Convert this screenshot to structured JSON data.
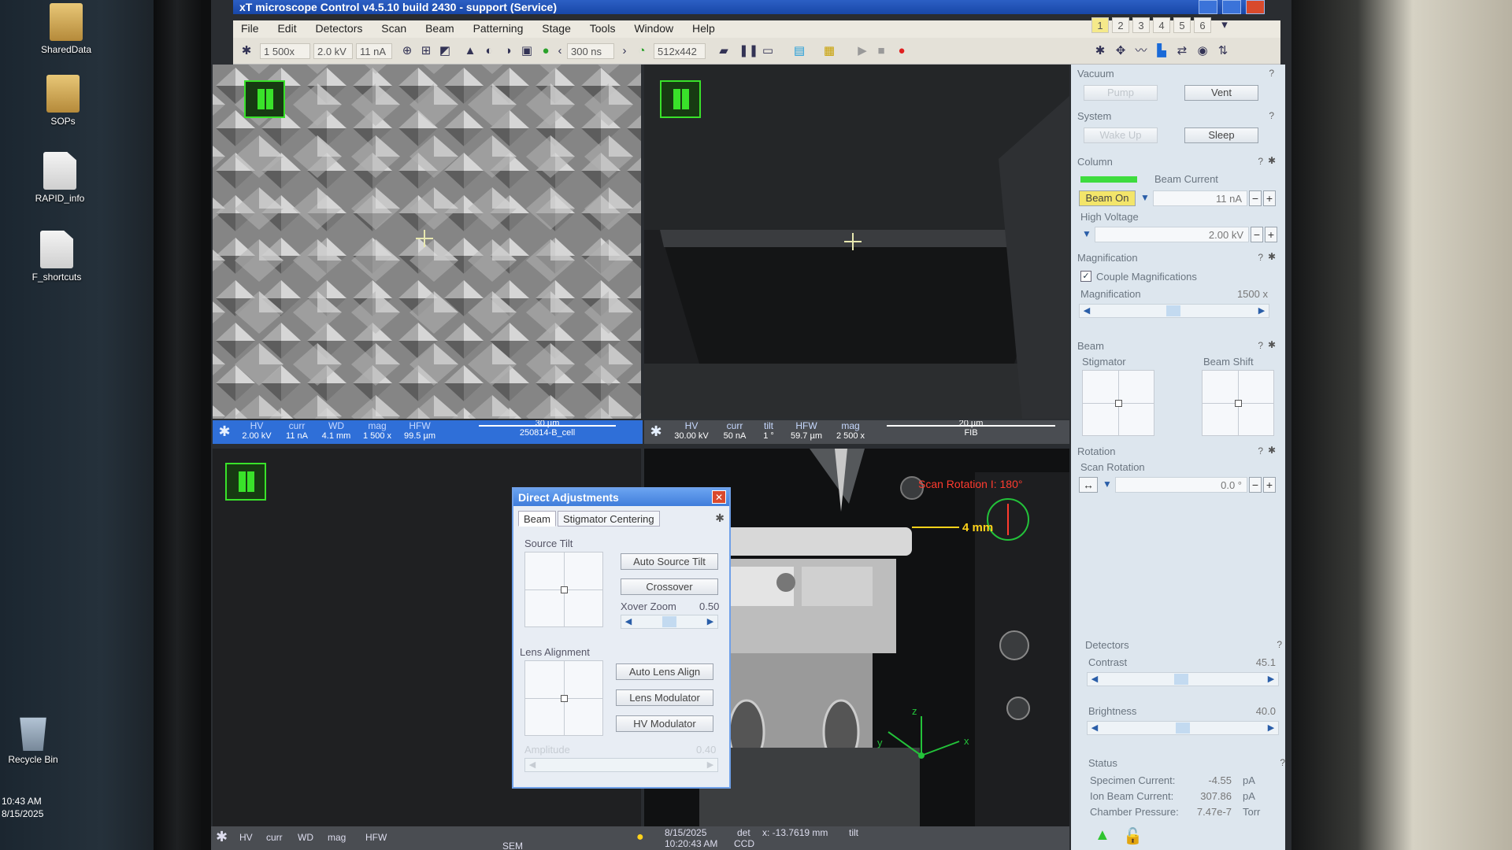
{
  "desktop": {
    "icons": [
      {
        "label": "SharedData"
      },
      {
        "label": "SOPs"
      },
      {
        "label": "RAPID_info"
      },
      {
        "label": "F_shortcuts"
      },
      {
        "label": "Recycle Bin"
      }
    ],
    "clock": {
      "time": "10:43 AM",
      "date": "8/15/2025"
    }
  },
  "window": {
    "title": "xT microscope Control v4.5.10 build 2430 - support (Service)"
  },
  "menu": [
    "File",
    "Edit",
    "Detectors",
    "Scan",
    "Beam",
    "Patterning",
    "Stage",
    "Tools",
    "Window",
    "Help"
  ],
  "toolbar": {
    "mag": "1 500x",
    "hv": "2.0 kV",
    "curr": "11 nA",
    "dwell": "300 ns",
    "resolution": "512x442"
  },
  "layout_tabs": [
    "1",
    "2",
    "3",
    "4",
    "5",
    "6"
  ],
  "sem_bar": {
    "hv_label": "HV",
    "hv_value": "2.00 kV",
    "curr_label": "curr",
    "curr_value": "11 nA",
    "wd_label": "WD",
    "wd_value": "4.1 mm",
    "mag_label": "mag",
    "mag_value": "1 500 x",
    "hfw_label": "HFW",
    "hfw_value": "99.5 µm",
    "scale_label": "30 µm",
    "sample_label": "250814-B_cell"
  },
  "fib_bar": {
    "hv_label": "HV",
    "hv_value": "30.00 kV",
    "curr_label": "curr",
    "curr_value": "50 nA",
    "tilt_label": "tilt",
    "tilt_value": "1 °",
    "hfw_label": "HFW",
    "hfw_value": "59.7 µm",
    "mag_label": "mag",
    "mag_value": "2 500 x",
    "scale_label": "20 µm",
    "mode_label": "FIB"
  },
  "ccd_view": {
    "scan_rotation": "Scan Rotation I: 180°",
    "distance": "4 mm",
    "axes": [
      "z",
      "y",
      "x"
    ]
  },
  "bottom_bar": {
    "labels": [
      "HV",
      "curr",
      "WD",
      "mag",
      "HFW"
    ],
    "mode": "SEM",
    "date": "8/15/2025",
    "time": "10:20:43 AM",
    "det_label": "det",
    "det_value": "CCD",
    "coord": "x: -13.7619 mm",
    "tilt_label": "tilt"
  },
  "dialog": {
    "title": "Direct Adjustments",
    "tabs": [
      "Beam",
      "Stigmator Centering"
    ],
    "source_tilt": "Source Tilt",
    "auto_source_tilt": "Auto Source Tilt",
    "crossover": "Crossover",
    "xover_zoom_label": "Xover Zoom",
    "xover_zoom_value": "0.50",
    "lens_alignment": "Lens Alignment",
    "auto_lens_align": "Auto Lens Align",
    "lens_modulator": "Lens Modulator",
    "hv_modulator": "HV Modulator",
    "amplitude_label": "Amplitude",
    "amplitude_value": "0.40"
  },
  "panel": {
    "vacuum": {
      "title": "Vacuum",
      "pump": "Pump",
      "vent": "Vent"
    },
    "system": {
      "title": "System",
      "wake_up": "Wake Up",
      "sleep": "Sleep"
    },
    "column": {
      "title": "Column",
      "beam_current_label": "Beam Current",
      "beam_on": "Beam On",
      "beam_current_value": "11 nA",
      "high_voltage_label": "High Voltage",
      "high_voltage_value": "2.00 kV"
    },
    "magnification": {
      "title": "Magnification",
      "couple": "Couple Magnifications",
      "mag_label": "Magnification",
      "mag_value": "1500 x"
    },
    "beam": {
      "title": "Beam",
      "stigmator": "Stigmator",
      "beam_shift": "Beam Shift"
    },
    "rotation": {
      "title": "Rotation",
      "scan_rotation_label": "Scan Rotation",
      "scan_rotation_value": "0.0 °"
    },
    "detectors": {
      "title": "Detectors",
      "contrast_label": "Contrast",
      "contrast_value": "45.1",
      "brightness_label": "Brightness",
      "brightness_value": "40.0"
    },
    "status": {
      "title": "Status",
      "rows": [
        {
          "label": "Specimen Current:",
          "value": "-4.55",
          "unit": "pA"
        },
        {
          "label": "Ion Beam Current:",
          "value": "307.86",
          "unit": "pA"
        },
        {
          "label": "Chamber Pressure:",
          "value": "7.47e-7",
          "unit": "Torr"
        }
      ]
    },
    "help": "?"
  },
  "colors": {
    "accent": "#2f6fd8",
    "pause_green": "#39e22a",
    "scan_rotation_red": "#ff3b2f",
    "distance_yellow": "#ffd21a"
  }
}
